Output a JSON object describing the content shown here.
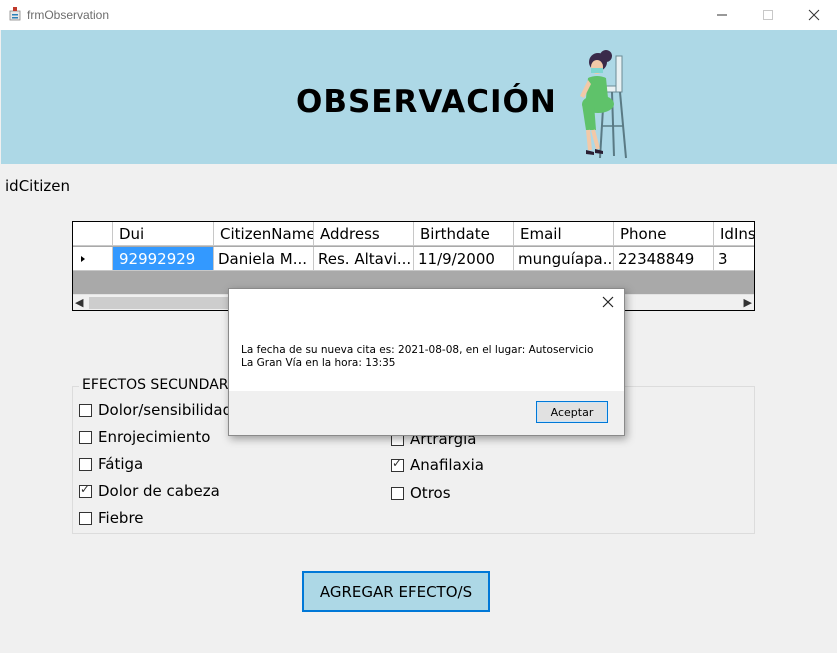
{
  "window": {
    "title": "frmObservation"
  },
  "banner": {
    "title": "OBSERVACIÓN",
    "bg_color": "#add8e6"
  },
  "form": {
    "id_label": "idCitizen"
  },
  "grid": {
    "columns": [
      "Dui",
      "CitizenName",
      "Address",
      "Birthdate",
      "Email",
      "Phone",
      "IdIns"
    ],
    "rows": [
      [
        "92992929",
        "Daniela M...",
        "Res. Altavi...",
        "11/9/2000",
        "munguíapa...",
        "22348849",
        "3"
      ]
    ]
  },
  "effects": {
    "legend": "EFECTOS SECUNDARIOS",
    "items_left": [
      {
        "label": "Dolor/sensibilidad",
        "checked": false
      },
      {
        "label": "Enrojecimiento",
        "checked": false
      },
      {
        "label": "Fátiga",
        "checked": false
      },
      {
        "label": "Dolor de cabeza",
        "checked": true
      },
      {
        "label": "Fiebre",
        "checked": false
      }
    ],
    "items_right": [
      {
        "label": "Artrargia",
        "checked": false
      },
      {
        "label": "Anafilaxia",
        "checked": true
      },
      {
        "label": "Otros",
        "checked": false
      }
    ]
  },
  "actions": {
    "add_label": "AGREGAR EFECTO/S"
  },
  "dialog": {
    "message": "La fecha de su nueva cita es: 2021-08-08, en el lugar: Autoservicio La Gran Vía en la hora: 13:35",
    "ok_label": "Aceptar"
  },
  "colors": {
    "accent": "#0078d7",
    "banner": "#add8e6",
    "selection": "#3399ff"
  }
}
